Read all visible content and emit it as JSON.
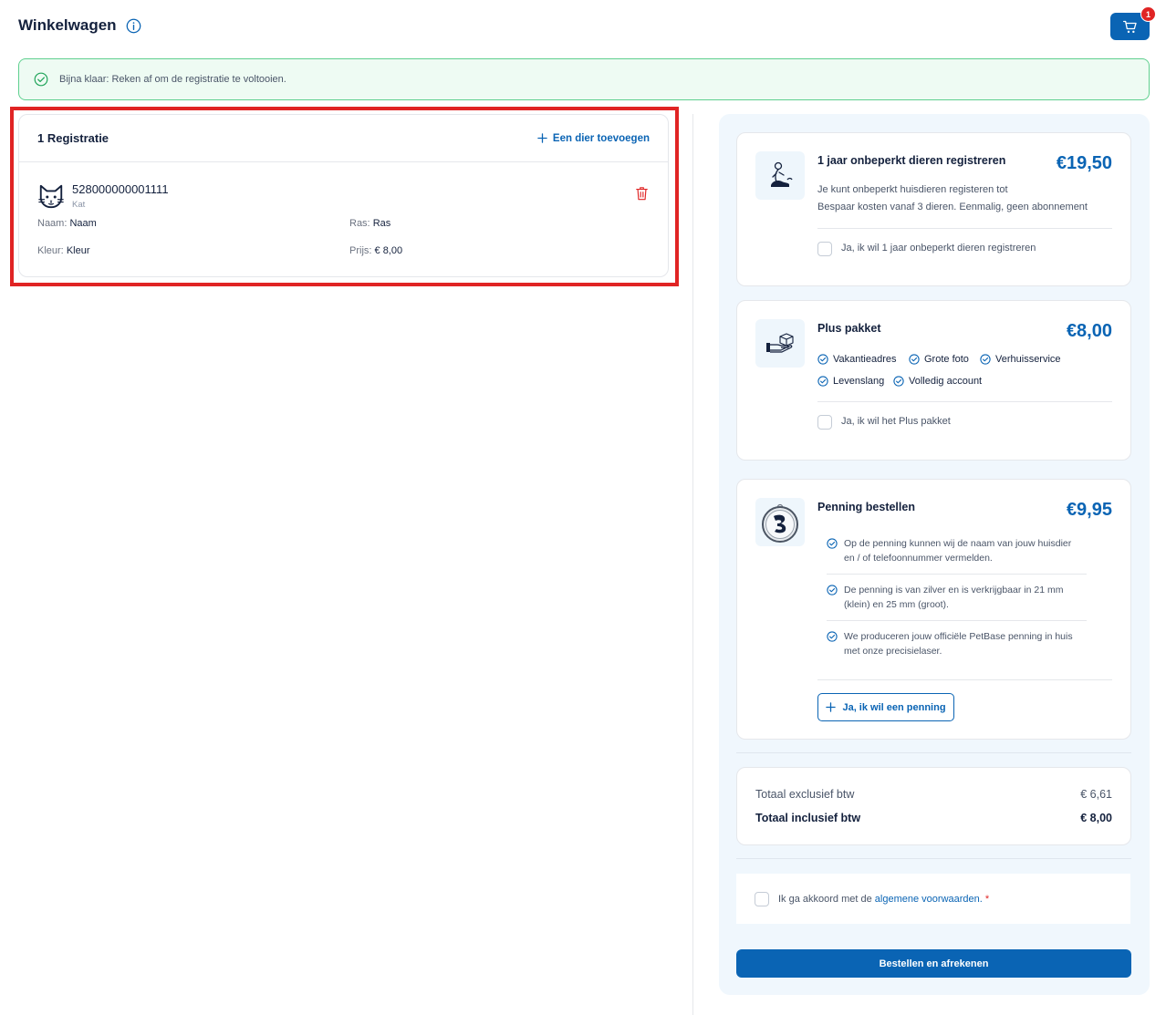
{
  "header": {
    "title": "Winkelwagen",
    "cart_count": "1"
  },
  "alert": {
    "text": "Bijna klaar: Reken af om de registratie te voltooien."
  },
  "registration": {
    "title": "1 Registratie",
    "add_label": "Een dier toevoegen",
    "animal": {
      "chip_number": "528000000001111",
      "type": "Kat",
      "name_label": "Naam:",
      "name_value": "Naam",
      "breed_label": "Ras:",
      "breed_value": "Ras",
      "color_label": "Kleur:",
      "color_value": "Kleur",
      "price_label": "Prijs:",
      "price_value": "€ 8,00"
    }
  },
  "products": {
    "unlimited": {
      "title": "1 jaar onbeperkt dieren registreren",
      "price": "€19,50",
      "desc_line1": "Je kunt onbeperkt huisdieren registeren tot",
      "desc_line2": "Bespaar kosten vanaf 3 dieren. Eenmalig, geen abonnement",
      "checkbox_label": "Ja, ik wil 1 jaar onbeperkt dieren registreren"
    },
    "plus": {
      "title": "Plus pakket",
      "price": "€8,00",
      "features": [
        "Vakantieadres",
        "Grote foto",
        "Verhuisservice",
        "Levenslang",
        "Volledig account"
      ],
      "checkbox_label": "Ja, ik wil het Plus pakket"
    },
    "penning": {
      "title": "Penning bestellen",
      "price": "€9,95",
      "items": [
        {
          "line1": "Op de penning kunnen wij de naam van jouw huisdier",
          "line2": "en / of telefoonnummer vermelden."
        },
        {
          "line1": "De penning is van zilver en is verkrijgbaar in 21 mm",
          "line2": "(klein) en 25 mm (groot)."
        },
        {
          "line1": "We produceren jouw officiële PetBase penning in huis",
          "line2": "met onze precisielaser."
        }
      ],
      "button_label": "Ja, ik wil een penning"
    }
  },
  "totals": {
    "excl_label": "Totaal exclusief btw",
    "excl_value": "€ 6,61",
    "incl_label": "Totaal inclusief btw",
    "incl_value": "€ 8,00"
  },
  "terms": {
    "prefix": "Ik ga akkoord met de",
    "link": "algemene voorwaarden.",
    "required": "*"
  },
  "order_button": "Bestellen en afrekenen",
  "colors": {
    "primary": "#0a64b4",
    "success": "#5fd08f",
    "danger": "#e02424",
    "panel": "#f0f7fd"
  }
}
